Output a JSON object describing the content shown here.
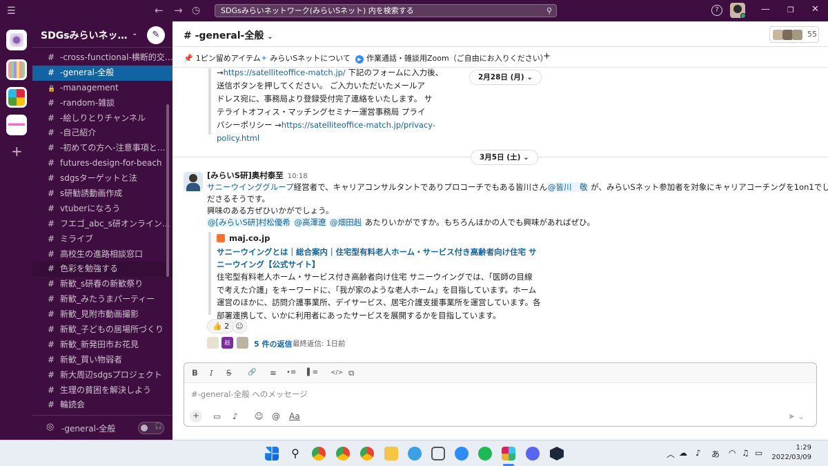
{
  "topbar": {
    "search_text": "SDGsみらいネットワーク(みらいSネット) 内を検索する",
    "help_label": "?"
  },
  "sidebar": {
    "workspace_name": "SDGsみらいネッ…",
    "channels": [
      {
        "label": "-cross-functional-横断的交…",
        "icon": "#"
      },
      {
        "label": "-general-全般",
        "icon": "#",
        "active": true
      },
      {
        "label": "-management",
        "icon": "lock"
      },
      {
        "label": "-random-雑談",
        "icon": "#"
      },
      {
        "label": "-絵しりとりチャンネル",
        "icon": "#"
      },
      {
        "label": "-自己紹介",
        "icon": "#"
      },
      {
        "label": "-初めての方へ-注意事項と…",
        "icon": "#"
      },
      {
        "label": "futures-design-for-beach",
        "icon": "#"
      },
      {
        "label": "sdgsターゲットと法",
        "icon": "#"
      },
      {
        "label": "s研勧誘動画作成",
        "icon": "#"
      },
      {
        "label": "vtuberになろう",
        "icon": "#"
      },
      {
        "label": "フエゴ_abc_s研オンライン…",
        "icon": "#"
      },
      {
        "label": "ミライブ",
        "icon": "#"
      },
      {
        "label": "高校生の進路相談窓口",
        "icon": "#"
      },
      {
        "label": "色彩を勉強する",
        "icon": "#",
        "hover": true
      },
      {
        "label": "新歓_s研春の新歓祭り",
        "icon": "#"
      },
      {
        "label": "新歓_みたうまパーティー",
        "icon": "#"
      },
      {
        "label": "新歓_見附市動画撮影",
        "icon": "#"
      },
      {
        "label": "新歓_子どもの居場所づくり",
        "icon": "#"
      },
      {
        "label": "新歓_新発田市お花見",
        "icon": "#"
      },
      {
        "label": "新歓_買い物弱者",
        "icon": "#"
      },
      {
        "label": "新大周辺sdgsプロジェクト",
        "icon": "#"
      },
      {
        "label": "生理の貧困を解決しよう",
        "icon": "#"
      },
      {
        "label": "輪読会",
        "icon": "#"
      }
    ],
    "huddle_label": "-general-全般"
  },
  "channel": {
    "title": "# -general-全般",
    "member_count": "55",
    "bookmarks": [
      {
        "icon": "📌",
        "label": "1ピン留めアイテム"
      },
      {
        "icon": "✦",
        "label": "みらいSネットについて"
      },
      {
        "icon": "▶",
        "label": "作業通話・雑談用Zoom（ご自由にお入りください）"
      }
    ],
    "add_bookmark": "+"
  },
  "feed": {
    "prev_quote": {
      "line1_arrow": "→",
      "line1_link": "https://satelliteoffice-match.jp/",
      "line1_rest": " 下記のフォームに入力後、",
      "line2": "送信ボタンを押してください。 ご入力いただいたメールア",
      "line3": "ドレス宛に、事務局より登録受付完了連絡をいたします。 サ",
      "line4": "テライトオフィス・マッチングセミナー運営事務局 プライ",
      "line5_text": "バシーポリシー →",
      "line5_link": "https://satelliteoffice-match.jp/privacy-",
      "line6_link": "policy.html"
    },
    "date1": "2月28日 (月) ⌄",
    "date2": "3月5日 (土) ⌄",
    "message": {
      "author": "[みらいS研]奥村泰至",
      "time": "10:18",
      "p1_link": "サニーウインググループ",
      "p1_a": "経営者で、キャリアコンサルタントでありプロコーチでもある皆川さん",
      "p1_mention": "@皆川　敬",
      "p1_b": " が、みらいSネット参加者を対象にキャリアコーチングを1on1でしてく",
      "p1_c": "ださるそうです。",
      "p2": "興味のある方ぜひいかがでしょう。",
      "p3_m1": "@[みらいS研]村松優希",
      "p3_m2": "@高澤遼",
      "p3_m3": "@畑田赳",
      "p3_rest": " あたりいかがですか。もちろんほかの人でも興味があればぜひ。",
      "unfurl": {
        "site": "maj.co.jp",
        "title1": "サニーウイングとは｜総合案内｜住宅型有料老人ホーム・サービス付き高齢者向け住宅 サ",
        "title2": "ニーウイング【公式サイト】",
        "desc1": "住宅型有料老人ホーム・サービス付き高齢者向け住宅 サニーウイングでは、「医師の目線",
        "desc2": "で考えた介護」をキーワードに、「我が家のような老人ホーム」を目指しています。ホーム",
        "desc3": "運営のほかに、訪問介護事業所、デイサービス、居宅介護支援事業所を運営しています。各",
        "desc4": "部署連携して、いかに利用者にあったサービスを展開するかを目指しています。"
      },
      "reaction_emoji": "👍",
      "reaction_count": "2",
      "replies_label": "5 件の返信",
      "last_reply": "最終返信: 1日前"
    }
  },
  "composer": {
    "placeholder": "#-general-全般 へのメッセージ",
    "format_buttons": [
      "B",
      "I",
      "S",
      "🔗",
      "≡",
      "•≡",
      "▌≡",
      "</>",
      "⧉"
    ]
  },
  "taskbar": {
    "time": "1:29",
    "date": "2022/03/09",
    "ime": "あ"
  },
  "colors": {
    "aubergine": "#3f0e40",
    "active_channel": "#1164a3",
    "link": "#1264a3"
  }
}
